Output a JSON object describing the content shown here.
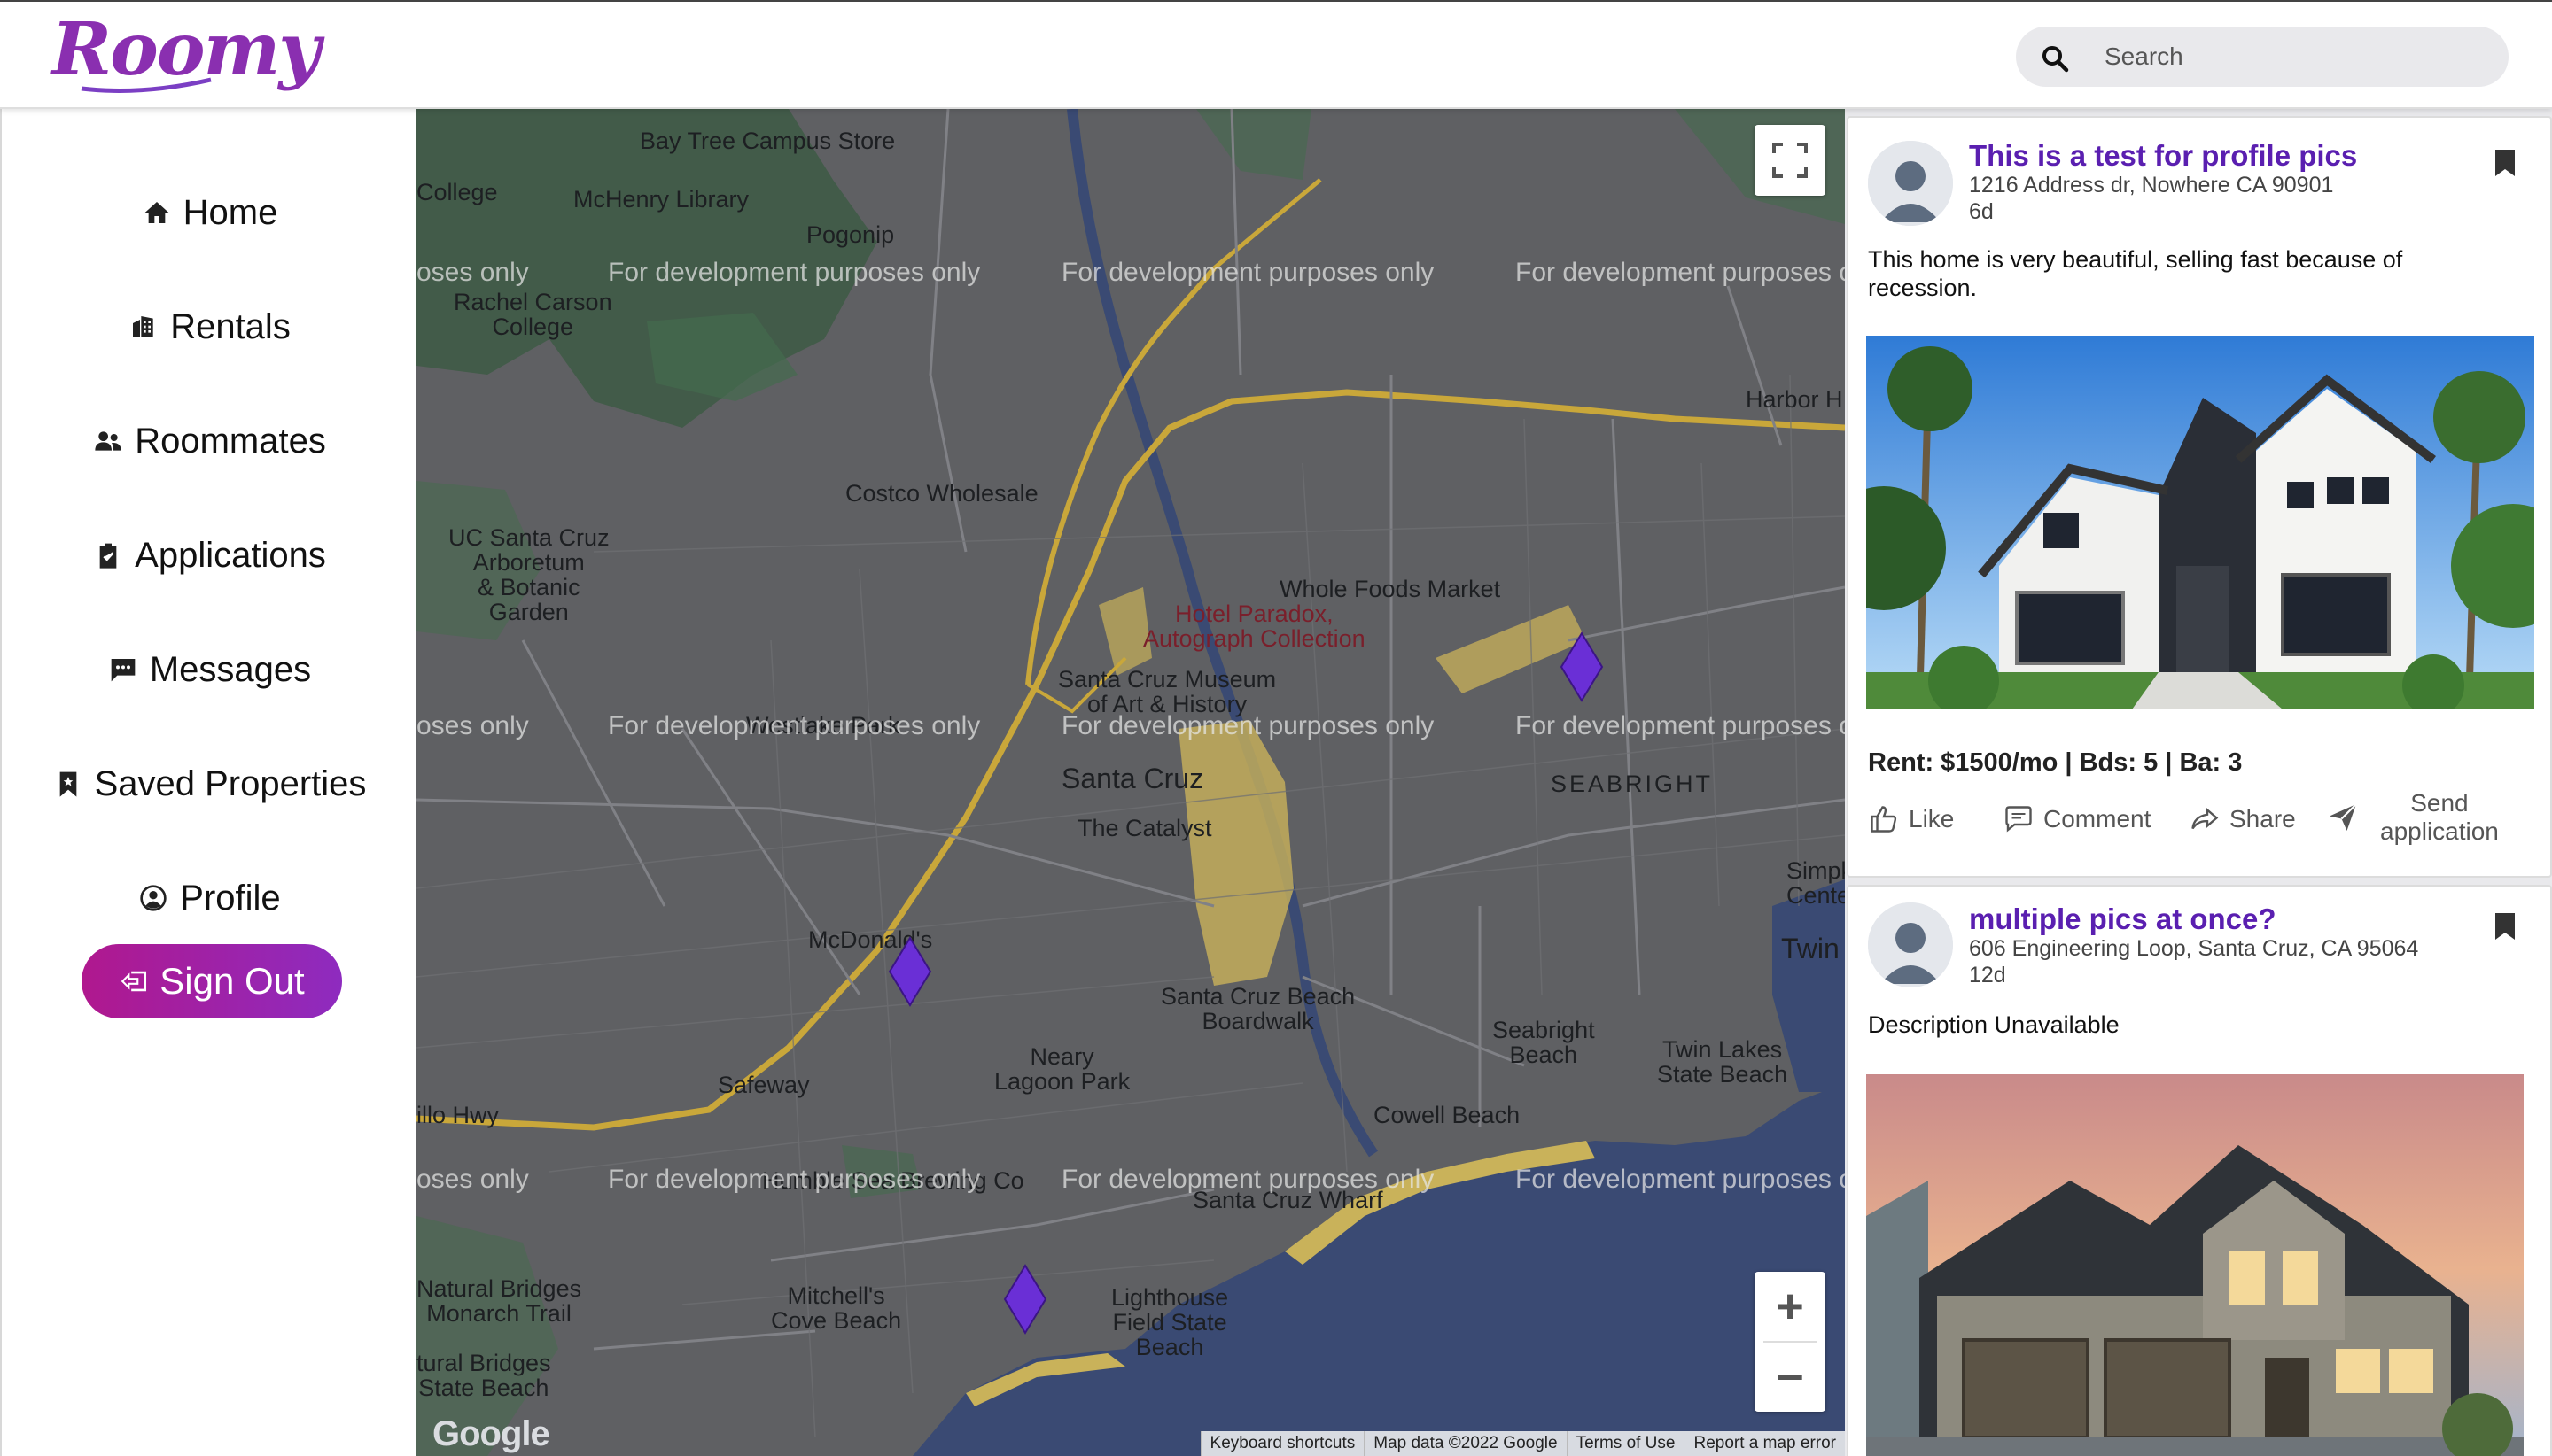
{
  "header": {
    "logo_text": "Roomy",
    "search_placeholder": "Search"
  },
  "sidebar": {
    "items": [
      {
        "label": "Home",
        "icon": "home-icon"
      },
      {
        "label": "Rentals",
        "icon": "building-icon"
      },
      {
        "label": "Roommates",
        "icon": "people-icon"
      },
      {
        "label": "Applications",
        "icon": "clipboard-icon"
      },
      {
        "label": "Messages",
        "icon": "message-icon"
      },
      {
        "label": "Saved Properties",
        "icon": "bookmark-icon"
      },
      {
        "label": "Profile",
        "icon": "user-circle-icon"
      }
    ],
    "signout_label": "Sign Out"
  },
  "map": {
    "watermark": "For development purposes only",
    "watermark_partial": "oses only",
    "labels": {
      "bay_tree": "Bay Tree Campus Store",
      "college": "College",
      "mchenry": "McHenry Library",
      "pogonip": "Pogonip",
      "rachel_carson": "Rachel Carson\nCollege",
      "harbor": "Harbor H",
      "costco": "Costco Wholesale",
      "ucsc_arboretum": "UC Santa Cruz\nArboretum\n& Botanic\nGarden",
      "whole_foods": "Whole Foods Market",
      "hotel_paradox": "Hotel Paradox,\nAutograph Collection",
      "museum": "Santa Cruz Museum\nof Art & History",
      "westlake": "Westlake Park",
      "seabright": "SEABRIGHT",
      "santa_cruz": "Santa Cruz",
      "catalyst": "The Catalyst",
      "simpkins": "Simpkins\nCente",
      "twin_lakes": "Twin Lak",
      "mcdonalds": "McDonald's",
      "boardwalk": "Santa Cruz Beach\nBoardwalk",
      "seabright_beach": "Seabright\nBeach",
      "twin_lakes_beach": "Twin Lakes\nState Beach",
      "safeway": "Safeway",
      "neary_lagoon": "Neary\nLagoon Park",
      "cowell": "Cowell Beach",
      "hwy": "illo Hwy",
      "humble_sea": "Humble Sea Brewing Co",
      "wharf": "Santa Cruz Wharf",
      "natural_bridges_trail": "Natural Bridges\nMonarch Trail",
      "mitchells_cove": "Mitchell's\nCove Beach",
      "lighthouse": "Lighthouse\nField State\nBeach",
      "natural_bridges_beach": "tural Bridges\nState Beach"
    },
    "google_logo": "Google",
    "footer": [
      "Keyboard shortcuts",
      "Map data ©2022 Google",
      "Terms of Use",
      "Report a map error"
    ],
    "zoom_in": "+",
    "zoom_out": "−"
  },
  "feed": {
    "posts": [
      {
        "title": "This is a test for profile pics",
        "address": "1216 Address dr, Nowhere CA 90901",
        "age": "6d",
        "description": "This home is very beautiful, selling fast because of recession.",
        "stats": "Rent: $1500/mo | Bds: 5 | Ba: 3",
        "actions": {
          "like": "Like",
          "comment": "Comment",
          "share": "Share",
          "send": "Send\napplication"
        }
      },
      {
        "title": "multiple pics at once?",
        "address": "606 Engineering Loop, Santa Cruz, CA 95064",
        "age": "12d",
        "description": "Description Unavailable"
      }
    ]
  },
  "colors": {
    "accent_purple": "#5a1fb0",
    "signout_gradient_start": "#b0188e",
    "signout_gradient_end": "#8e2bbf",
    "marker": "#6a2fd6",
    "map_background": "#5f6063",
    "water": "#3a4a73"
  }
}
